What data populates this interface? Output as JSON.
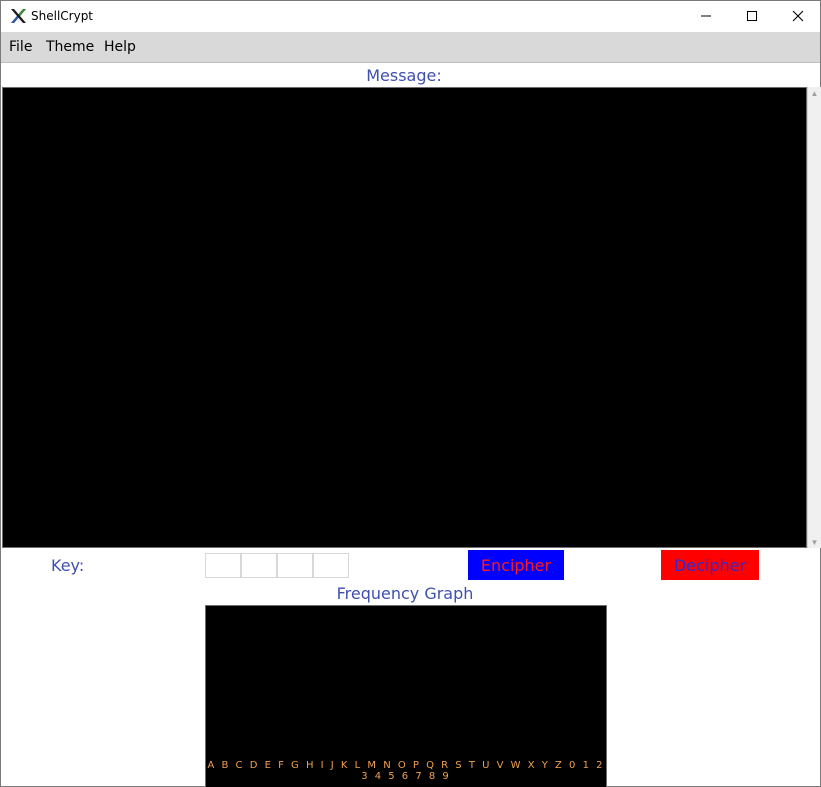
{
  "window": {
    "title": "ShellCrypt"
  },
  "menu": {
    "items": [
      "File",
      "Theme",
      "Help"
    ]
  },
  "message": {
    "label": "Message:",
    "text": ""
  },
  "key": {
    "label": "Key:",
    "boxes": [
      "",
      "",
      "",
      ""
    ]
  },
  "buttons": {
    "encipher": "Encipher",
    "decipher": "Decipher"
  },
  "frequency_graph": {
    "label": "Frequency Graph",
    "axis_letters": "A B C D E F G H I  J K L M N O P Q R S T U V W X Y Z 0 1 2 3 4 5 6 7 8 9"
  },
  "colors": {
    "label_text": "#3f4fae",
    "encipher_bg": "#0000ff",
    "encipher_text": "#ff1a1a",
    "decipher_bg": "#ff0000",
    "decipher_text": "#2b2bd6",
    "graph_letters": "#f0a050"
  }
}
